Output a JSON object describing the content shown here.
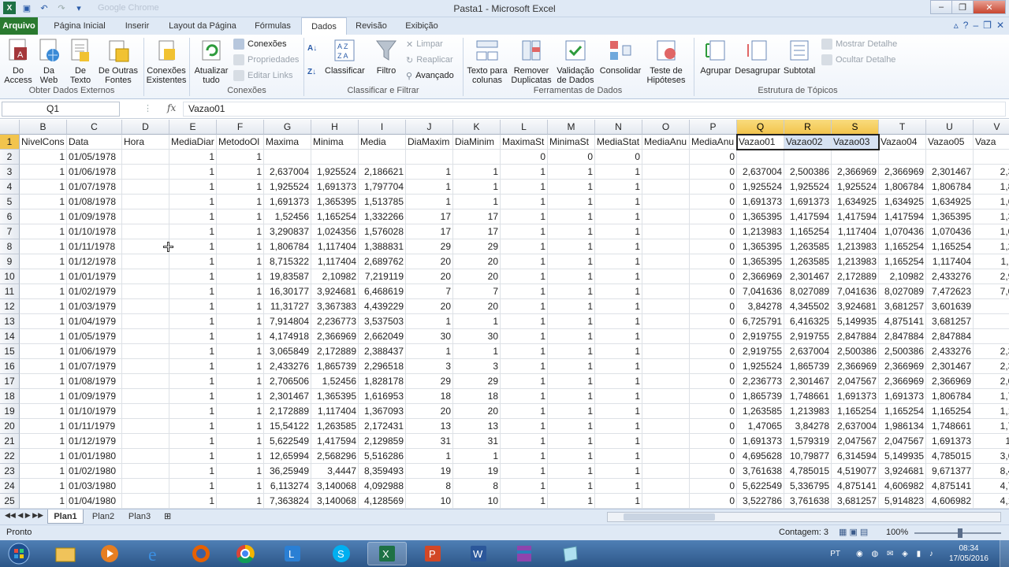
{
  "window": {
    "title": "Pasta1 - Microsoft Excel",
    "qat_extra": "Google Chrome"
  },
  "tabs": [
    "Arquivo",
    "Página Inicial",
    "Inserir",
    "Layout da Página",
    "Fórmulas",
    "Dados",
    "Revisão",
    "Exibição"
  ],
  "active_tab": "Dados",
  "ribbon": {
    "get_external": {
      "buttons": [
        "Do Access",
        "Da Web",
        "De Texto",
        "De Outras Fontes"
      ],
      "label": "Obter Dados Externos"
    },
    "existing": "Conexões Existentes",
    "connections": {
      "refresh": "Atualizar tudo",
      "items": [
        "Conexões",
        "Propriedades",
        "Editar Links"
      ],
      "label": "Conexões"
    },
    "sort": {
      "sort": "Classificar",
      "filter": "Filtro",
      "items": [
        "Limpar",
        "Reaplicar",
        "Avançado"
      ],
      "label": "Classificar e Filtrar"
    },
    "tools": {
      "buttons": [
        "Texto para colunas",
        "Remover Duplicatas",
        "Validação de Dados",
        "Consolidar",
        "Teste de Hipóteses"
      ],
      "label": "Ferramentas de Dados"
    },
    "outline": {
      "buttons": [
        "Agrupar",
        "Desagrupar",
        "Subtotal"
      ],
      "items": [
        "Mostrar Detalhe",
        "Ocultar Detalhe"
      ],
      "label": "Estrutura de Tópicos"
    }
  },
  "formula": {
    "namebox": "Q1",
    "fx": "fx",
    "content": "Vazao01"
  },
  "columns": [
    "B",
    "C",
    "D",
    "E",
    "F",
    "G",
    "H",
    "I",
    "J",
    "K",
    "L",
    "M",
    "N",
    "O",
    "P",
    "Q",
    "R",
    "S",
    "T",
    "U",
    "V"
  ],
  "header_row": [
    "NivelCons",
    "Data",
    "Hora",
    "MediaDiar",
    "MetodoOl",
    "Maxima",
    "Minima",
    "Media",
    "DiaMaxim",
    "DiaMinim",
    "MaximaSt",
    "MinimaSt",
    "MediaStat",
    "MediaAnu",
    "MediaAnu",
    "Vazao01",
    "Vazao02",
    "Vazao03",
    "Vazao04",
    "Vazao05",
    "Vaza"
  ],
  "rows": [
    [
      "1",
      "01/05/1978",
      "",
      "1",
      "1",
      "",
      "",
      "",
      "",
      "",
      "0",
      "0",
      "0",
      "",
      "0",
      "",
      "",
      "",
      "",
      "",
      ""
    ],
    [
      "1",
      "01/06/1978",
      "",
      "1",
      "1",
      "2,637004",
      "1,925524",
      "2,186621",
      "1",
      "1",
      "1",
      "1",
      "1",
      "",
      "0",
      "2,637004",
      "2,500386",
      "2,366969",
      "2,366969",
      "2,301467",
      "2,30"
    ],
    [
      "1",
      "01/07/1978",
      "",
      "1",
      "1",
      "1,925524",
      "1,691373",
      "1,797704",
      "1",
      "1",
      "1",
      "1",
      "1",
      "",
      "0",
      "1,925524",
      "1,925524",
      "1,925524",
      "1,806784",
      "1,806784",
      "1,80"
    ],
    [
      "1",
      "01/08/1978",
      "",
      "1",
      "1",
      "1,691373",
      "1,365395",
      "1,513785",
      "1",
      "1",
      "1",
      "1",
      "1",
      "",
      "0",
      "1,691373",
      "1,691373",
      "1,634925",
      "1,634925",
      "1,634925",
      "1,63"
    ],
    [
      "1",
      "01/09/1978",
      "",
      "1",
      "1",
      "1,52456",
      "1,165254",
      "1,332266",
      "17",
      "17",
      "1",
      "1",
      "1",
      "",
      "0",
      "1,365395",
      "1,417594",
      "1,417594",
      "1,417594",
      "1,365395",
      "1,36"
    ],
    [
      "1",
      "01/10/1978",
      "",
      "1",
      "1",
      "3,290837",
      "1,024356",
      "1,576028",
      "17",
      "17",
      "1",
      "1",
      "1",
      "",
      "0",
      "1,213983",
      "1,165254",
      "1,117404",
      "1,070436",
      "1,070436",
      "1,07"
    ],
    [
      "1",
      "01/11/1978",
      "",
      "1",
      "1",
      "1,806784",
      "1,117404",
      "1,388831",
      "29",
      "29",
      "1",
      "1",
      "1",
      "",
      "0",
      "1,365395",
      "1,263585",
      "1,213983",
      "1,165254",
      "1,165254",
      "1,21"
    ],
    [
      "1",
      "01/12/1978",
      "",
      "1",
      "1",
      "8,715322",
      "1,117404",
      "2,689762",
      "20",
      "20",
      "1",
      "1",
      "1",
      "",
      "0",
      "1,365395",
      "1,263585",
      "1,213983",
      "1,165254",
      "1,117404",
      "1,11"
    ],
    [
      "1",
      "01/01/1979",
      "",
      "1",
      "1",
      "19,83587",
      "2,10982",
      "7,219119",
      "20",
      "20",
      "1",
      "1",
      "1",
      "",
      "0",
      "2,366969",
      "2,301467",
      "2,172889",
      "2,10982",
      "2,433276",
      "2,91"
    ],
    [
      "1",
      "01/02/1979",
      "",
      "1",
      "1",
      "16,30177",
      "3,924681",
      "6,468619",
      "7",
      "7",
      "1",
      "1",
      "1",
      "",
      "0",
      "7,041636",
      "8,027089",
      "7,041636",
      "8,027089",
      "7,472623",
      "7,04"
    ],
    [
      "1",
      "01/03/1979",
      "",
      "1",
      "1",
      "11,31727",
      "3,367383",
      "4,439229",
      "20",
      "20",
      "1",
      "1",
      "1",
      "",
      "0",
      "3,84278",
      "4,345502",
      "3,924681",
      "3,681257",
      "3,601639",
      "3"
    ],
    [
      "1",
      "01/04/1979",
      "",
      "1",
      "1",
      "7,914804",
      "2,236773",
      "3,537503",
      "1",
      "1",
      "1",
      "1",
      "1",
      "",
      "0",
      "6,725791",
      "6,416325",
      "5,149935",
      "4,875141",
      "3,681257",
      "3"
    ],
    [
      "1",
      "01/05/1979",
      "",
      "1",
      "1",
      "4,174918",
      "2,366969",
      "2,662049",
      "30",
      "30",
      "1",
      "1",
      "1",
      "",
      "0",
      "2,919755",
      "2,919755",
      "2,847884",
      "2,847884",
      "2,847884",
      "2,"
    ],
    [
      "1",
      "01/06/1979",
      "",
      "1",
      "1",
      "3,065849",
      "2,172889",
      "2,388437",
      "1",
      "1",
      "1",
      "1",
      "1",
      "",
      "0",
      "2,919755",
      "2,637004",
      "2,500386",
      "2,500386",
      "2,433276",
      "2,36"
    ],
    [
      "1",
      "01/07/1979",
      "",
      "1",
      "1",
      "2,433276",
      "1,865739",
      "2,296518",
      "3",
      "3",
      "1",
      "1",
      "1",
      "",
      "0",
      "1,925524",
      "1,865739",
      "2,366969",
      "2,366969",
      "2,301467",
      "2,30"
    ],
    [
      "1",
      "01/08/1979",
      "",
      "1",
      "1",
      "2,706506",
      "1,52456",
      "1,828178",
      "29",
      "29",
      "1",
      "1",
      "1",
      "",
      "0",
      "2,236773",
      "2,301467",
      "2,047567",
      "2,366969",
      "2,366969",
      "2,04"
    ],
    [
      "1",
      "01/09/1979",
      "",
      "1",
      "1",
      "2,301467",
      "1,365395",
      "1,616953",
      "18",
      "18",
      "1",
      "1",
      "1",
      "",
      "0",
      "1,865739",
      "1,748661",
      "1,691373",
      "1,691373",
      "1,806784",
      "1,71"
    ],
    [
      "1",
      "01/10/1979",
      "",
      "1",
      "1",
      "2,172889",
      "1,117404",
      "1,367093",
      "20",
      "20",
      "1",
      "1",
      "1",
      "",
      "0",
      "1,263585",
      "1,213983",
      "1,165254",
      "1,165254",
      "1,165254",
      "1,16"
    ],
    [
      "1",
      "01/11/1979",
      "",
      "1",
      "1",
      "15,54122",
      "1,263585",
      "2,172431",
      "13",
      "13",
      "1",
      "1",
      "1",
      "",
      "0",
      "1,47065",
      "3,84278",
      "2,637004",
      "1,986134",
      "1,748661",
      "1,74"
    ],
    [
      "1",
      "01/12/1979",
      "",
      "1",
      "1",
      "5,622549",
      "1,417594",
      "2,129859",
      "31",
      "31",
      "1",
      "1",
      "1",
      "",
      "0",
      "1,691373",
      "1,579319",
      "2,047567",
      "2,047567",
      "1,691373",
      "1,5"
    ],
    [
      "1",
      "01/01/1980",
      "",
      "1",
      "1",
      "12,65994",
      "2,568296",
      "5,516286",
      "1",
      "1",
      "1",
      "1",
      "1",
      "",
      "0",
      "4,695628",
      "10,79877",
      "6,314594",
      "5,149935",
      "4,785015",
      "3,68"
    ],
    [
      "1",
      "01/02/1980",
      "",
      "1",
      "1",
      "36,25949",
      "3,4447",
      "8,359493",
      "19",
      "19",
      "1",
      "1",
      "1",
      "",
      "0",
      "3,761638",
      "4,785015",
      "4,519077",
      "3,924681",
      "9,671377",
      "8,48"
    ],
    [
      "1",
      "01/03/1980",
      "",
      "1",
      "1",
      "6,113274",
      "3,140068",
      "4,092988",
      "8",
      "8",
      "1",
      "1",
      "1",
      "",
      "0",
      "5,622549",
      "5,336795",
      "4,875141",
      "4,606982",
      "4,875141",
      "4,78"
    ],
    [
      "1",
      "01/04/1980",
      "",
      "1",
      "1",
      "7,363824",
      "3,140068",
      "4,128569",
      "10",
      "10",
      "1",
      "1",
      "1",
      "",
      "0",
      "3,522786",
      "3,761638",
      "3,681257",
      "5,914823",
      "4,606982",
      "4,17"
    ]
  ],
  "sheets": [
    "Plan1",
    "Plan2",
    "Plan3"
  ],
  "status": {
    "ready": "Pronto",
    "count": "Contagem: 3",
    "zoom": "100%"
  },
  "tray": {
    "lang": "PT",
    "time": "08:34",
    "date": "17/05/2016"
  }
}
